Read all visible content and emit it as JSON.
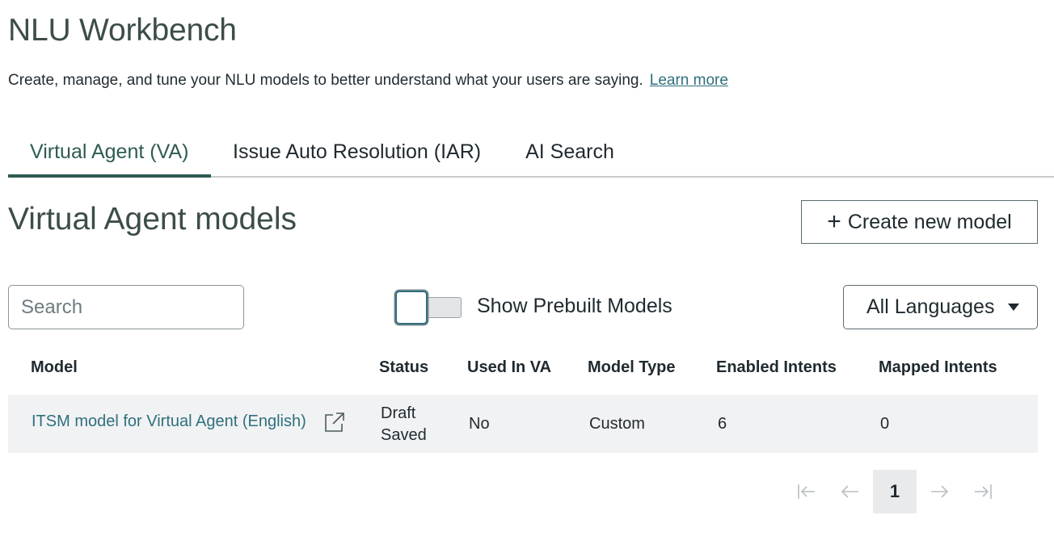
{
  "page": {
    "title": "NLU Workbench",
    "description": "Create, manage, and tune your NLU models to better understand what your users are saying.",
    "learn_more": "Learn more"
  },
  "tabs": [
    {
      "label": "Virtual Agent (VA)",
      "active": true
    },
    {
      "label": "Issue Auto Resolution (IAR)",
      "active": false
    },
    {
      "label": "AI Search",
      "active": false
    }
  ],
  "section": {
    "title": "Virtual Agent models",
    "create_button": "Create new model"
  },
  "filters": {
    "search_placeholder": "Search",
    "search_value": "",
    "toggle_label": "Show Prebuilt Models",
    "toggle_on": false,
    "language_selected": "All Languages"
  },
  "table": {
    "columns": [
      "Model",
      "Status",
      "Used In VA",
      "Model Type",
      "Enabled Intents",
      "Mapped Intents"
    ],
    "rows": [
      {
        "model": "ITSM model for Virtual Agent (English)",
        "status_line1": "Draft",
        "status_line2": "Saved",
        "used_in_va": "No",
        "model_type": "Custom",
        "enabled_intents": "6",
        "mapped_intents": "0"
      }
    ]
  },
  "pagination": {
    "current_page": "1",
    "icons": [
      "first-page-icon",
      "prev-page-icon",
      "next-page-icon",
      "last-page-icon"
    ]
  },
  "colors": {
    "accent": "#2e5b52",
    "link": "#2f6f7e",
    "row_bg": "#f1f2f3"
  }
}
